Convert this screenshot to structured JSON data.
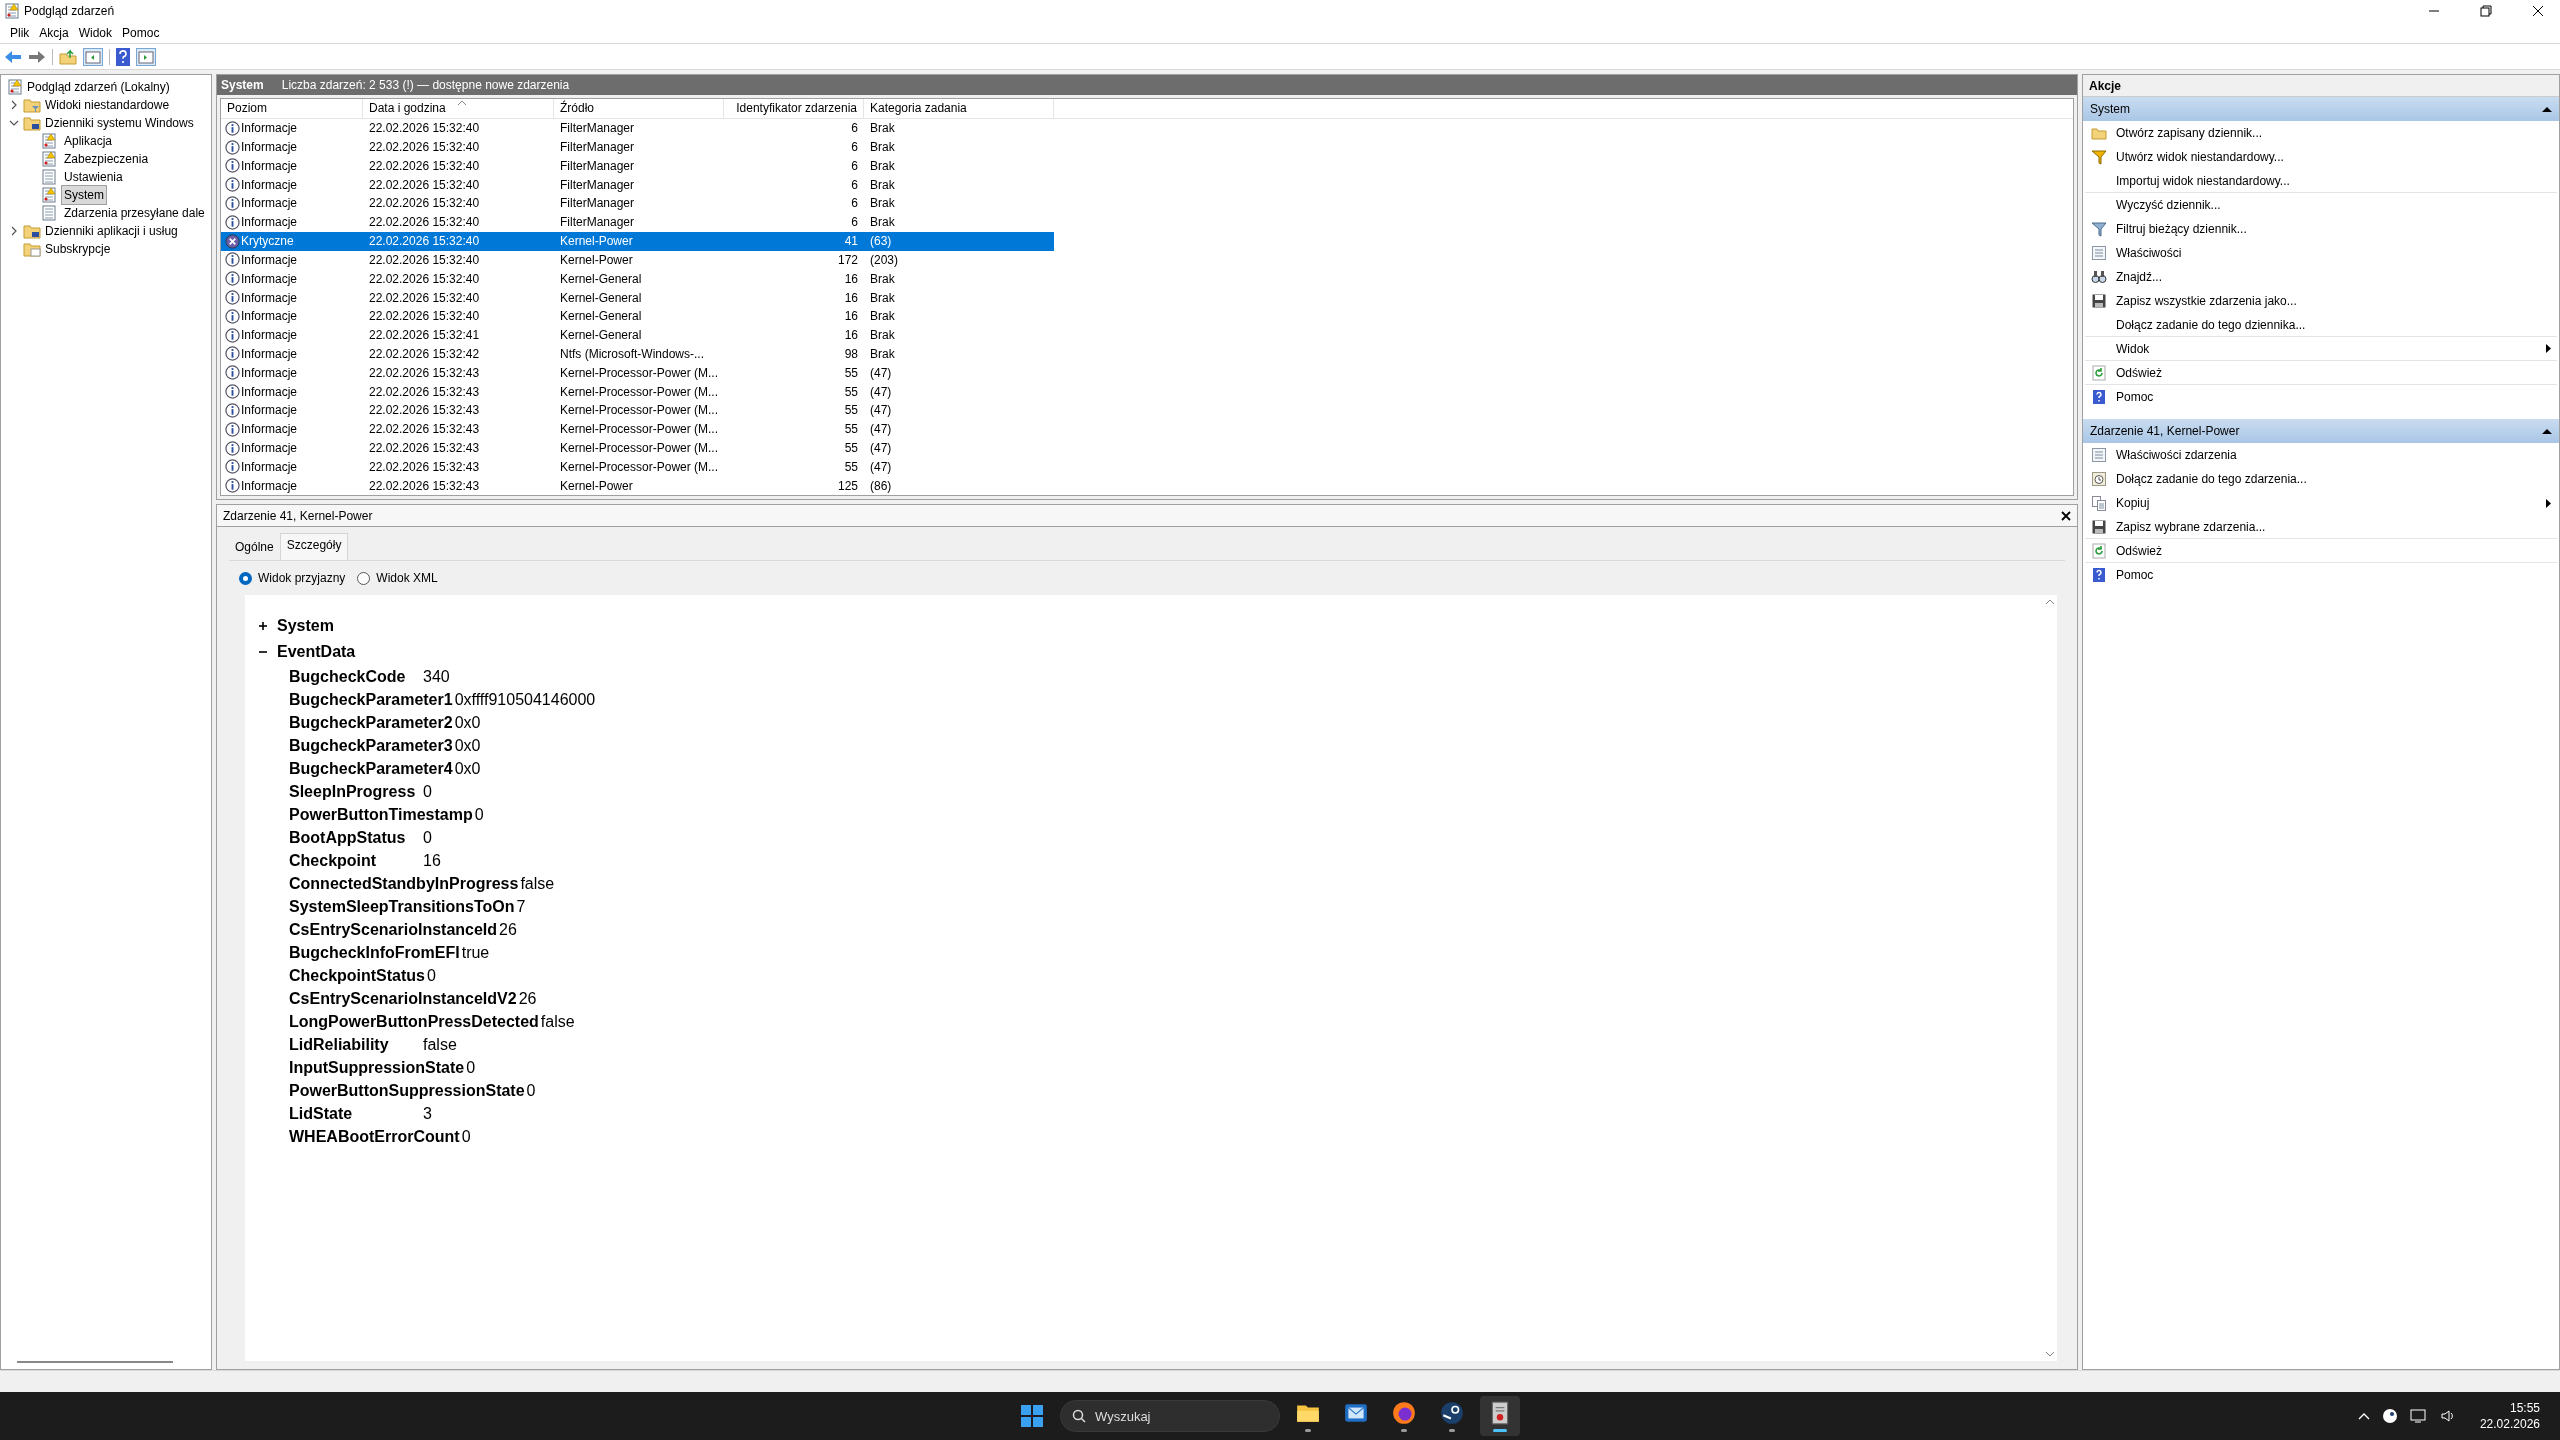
{
  "window": {
    "title": "Podgląd zdarzeń"
  },
  "menu": [
    "Plik",
    "Akcja",
    "Widok",
    "Pomoc"
  ],
  "tree": {
    "label": "Podgląd zdarzeń (Lokalny)",
    "children": [
      {
        "label": "Widoki niestandardowe",
        "kind": "filter-folder",
        "expander": true,
        "expanded": false
      },
      {
        "label": "Dzienniki systemu Windows",
        "kind": "folder",
        "expander": true,
        "expanded": true,
        "children": [
          {
            "label": "Aplikacja",
            "kind": "log-alert",
            "selected": false
          },
          {
            "label": "Zabezpieczenia",
            "kind": "log-alert",
            "selected": false
          },
          {
            "label": "Ustawienia",
            "kind": "log",
            "selected": false
          },
          {
            "label": "System",
            "kind": "log-alert",
            "selected": true
          },
          {
            "label": "Zdarzenia przesyłane dale",
            "kind": "log",
            "selected": false
          }
        ]
      },
      {
        "label": "Dzienniki aplikacji i usług",
        "kind": "folder",
        "expander": true,
        "expanded": false
      },
      {
        "label": "Subskrypcje",
        "kind": "subscription",
        "expander": false
      }
    ]
  },
  "log_header": {
    "title": "System",
    "summary": "Liczba zdarzeń: 2 533 (!) — dostępne nowe zdarzenia"
  },
  "table": {
    "columns": [
      {
        "label": "Poziom",
        "sorted": false
      },
      {
        "label": "Data i godzina",
        "sorted": true
      },
      {
        "label": "Źródło",
        "sorted": false
      },
      {
        "label": "Identyfikator zdarzenia",
        "sorted": false
      },
      {
        "label": "Kategoria zadania",
        "sorted": false
      }
    ],
    "rows": [
      {
        "kind": "info",
        "severity": "Informacje",
        "date": "22.02.2026 15:32:40",
        "source": "FilterManager",
        "id": "6",
        "category": "Brak",
        "selected": false
      },
      {
        "kind": "info",
        "severity": "Informacje",
        "date": "22.02.2026 15:32:40",
        "source": "FilterManager",
        "id": "6",
        "category": "Brak",
        "selected": false
      },
      {
        "kind": "info",
        "severity": "Informacje",
        "date": "22.02.2026 15:32:40",
        "source": "FilterManager",
        "id": "6",
        "category": "Brak",
        "selected": false
      },
      {
        "kind": "info",
        "severity": "Informacje",
        "date": "22.02.2026 15:32:40",
        "source": "FilterManager",
        "id": "6",
        "category": "Brak",
        "selected": false
      },
      {
        "kind": "info",
        "severity": "Informacje",
        "date": "22.02.2026 15:32:40",
        "source": "FilterManager",
        "id": "6",
        "category": "Brak",
        "selected": false
      },
      {
        "kind": "info",
        "severity": "Informacje",
        "date": "22.02.2026 15:32:40",
        "source": "FilterManager",
        "id": "6",
        "category": "Brak",
        "selected": false
      },
      {
        "kind": "critical",
        "severity": "Krytyczne",
        "date": "22.02.2026 15:32:40",
        "source": "Kernel-Power",
        "id": "41",
        "category": "(63)",
        "selected": true
      },
      {
        "kind": "info",
        "severity": "Informacje",
        "date": "22.02.2026 15:32:40",
        "source": "Kernel-Power",
        "id": "172",
        "category": "(203)",
        "selected": false
      },
      {
        "kind": "info",
        "severity": "Informacje",
        "date": "22.02.2026 15:32:40",
        "source": "Kernel-General",
        "id": "16",
        "category": "Brak",
        "selected": false
      },
      {
        "kind": "info",
        "severity": "Informacje",
        "date": "22.02.2026 15:32:40",
        "source": "Kernel-General",
        "id": "16",
        "category": "Brak",
        "selected": false
      },
      {
        "kind": "info",
        "severity": "Informacje",
        "date": "22.02.2026 15:32:40",
        "source": "Kernel-General",
        "id": "16",
        "category": "Brak",
        "selected": false
      },
      {
        "kind": "info",
        "severity": "Informacje",
        "date": "22.02.2026 15:32:41",
        "source": "Kernel-General",
        "id": "16",
        "category": "Brak",
        "selected": false
      },
      {
        "kind": "info",
        "severity": "Informacje",
        "date": "22.02.2026 15:32:42",
        "source": "Ntfs (Microsoft-Windows-...",
        "id": "98",
        "category": "Brak",
        "selected": false
      },
      {
        "kind": "info",
        "severity": "Informacje",
        "date": "22.02.2026 15:32:43",
        "source": "Kernel-Processor-Power (M...",
        "id": "55",
        "category": "(47)",
        "selected": false
      },
      {
        "kind": "info",
        "severity": "Informacje",
        "date": "22.02.2026 15:32:43",
        "source": "Kernel-Processor-Power (M...",
        "id": "55",
        "category": "(47)",
        "selected": false
      },
      {
        "kind": "info",
        "severity": "Informacje",
        "date": "22.02.2026 15:32:43",
        "source": "Kernel-Processor-Power (M...",
        "id": "55",
        "category": "(47)",
        "selected": false
      },
      {
        "kind": "info",
        "severity": "Informacje",
        "date": "22.02.2026 15:32:43",
        "source": "Kernel-Processor-Power (M...",
        "id": "55",
        "category": "(47)",
        "selected": false
      },
      {
        "kind": "info",
        "severity": "Informacje",
        "date": "22.02.2026 15:32:43",
        "source": "Kernel-Processor-Power (M...",
        "id": "55",
        "category": "(47)",
        "selected": false
      },
      {
        "kind": "info",
        "severity": "Informacje",
        "date": "22.02.2026 15:32:43",
        "source": "Kernel-Processor-Power (M...",
        "id": "55",
        "category": "(47)",
        "selected": false
      },
      {
        "kind": "info",
        "severity": "Informacje",
        "date": "22.02.2026 15:32:43",
        "source": "Kernel-Power",
        "id": "125",
        "category": "(86)",
        "selected": false
      }
    ]
  },
  "details": {
    "title": "Zdarzenie 41, Kernel-Power",
    "tabs": [
      {
        "label": "Ogólne",
        "selected": false
      },
      {
        "label": "Szczegóły",
        "selected": true
      }
    ],
    "view_options": [
      {
        "label": "Widok przyjazny",
        "selected": true
      },
      {
        "label": "Widok XML",
        "selected": false
      }
    ],
    "sections": [
      {
        "label": "System",
        "expanded": false
      },
      {
        "label": "EventData",
        "expanded": true,
        "fields": [
          {
            "name": "BugcheckCode",
            "value": "340"
          },
          {
            "name": "BugcheckParameter1",
            "value": "0xffff910504146000"
          },
          {
            "name": "BugcheckParameter2",
            "value": "0x0"
          },
          {
            "name": "BugcheckParameter3",
            "value": "0x0"
          },
          {
            "name": "BugcheckParameter4",
            "value": "0x0"
          },
          {
            "name": "SleepInProgress",
            "value": "0"
          },
          {
            "name": "PowerButtonTimestamp",
            "value": "0"
          },
          {
            "name": "BootAppStatus",
            "value": "0"
          },
          {
            "name": "Checkpoint",
            "value": "16"
          },
          {
            "name": "ConnectedStandbyInProgress",
            "value": "false"
          },
          {
            "name": "SystemSleepTransitionsToOn",
            "value": "7"
          },
          {
            "name": "CsEntryScenarioInstanceId",
            "value": "26"
          },
          {
            "name": "BugcheckInfoFromEFI",
            "value": "true"
          },
          {
            "name": "CheckpointStatus",
            "value": "0"
          },
          {
            "name": "CsEntryScenarioInstanceIdV2",
            "value": "26"
          },
          {
            "name": "LongPowerButtonPressDetected",
            "value": "false"
          },
          {
            "name": "LidReliability",
            "value": "false"
          },
          {
            "name": "InputSuppressionState",
            "value": "0"
          },
          {
            "name": "PowerButtonSuppressionState",
            "value": "0"
          },
          {
            "name": "LidState",
            "value": "3"
          },
          {
            "name": "WHEABootErrorCount",
            "value": "0"
          }
        ]
      }
    ]
  },
  "actions": {
    "title": "Akcje",
    "groups": [
      {
        "title": "System",
        "expanded": true,
        "items": [
          {
            "label": "Otwórz zapisany dziennik...",
            "kind": "open",
            "submenu": false,
            "divider_after": false
          },
          {
            "label": "Utwórz widok niestandardowy...",
            "kind": "filter-new",
            "submenu": false,
            "divider_after": false
          },
          {
            "label": "Importuj widok niestandardowy...",
            "kind": "none",
            "submenu": false,
            "divider_after": true
          },
          {
            "label": "Wyczyść dziennik...",
            "kind": "none",
            "submenu": false,
            "divider_after": false
          },
          {
            "label": "Filtruj bieżący dziennik...",
            "kind": "filter",
            "submenu": false,
            "divider_after": false
          },
          {
            "label": "Właściwości",
            "kind": "properties",
            "submenu": false,
            "divider_after": false
          },
          {
            "label": "Znajdź...",
            "kind": "find",
            "submenu": false,
            "divider_after": false
          },
          {
            "label": "Zapisz wszystkie zdarzenia jako...",
            "kind": "save",
            "submenu": false,
            "divider_after": false
          },
          {
            "label": "Dołącz zadanie do tego dziennika...",
            "kind": "none",
            "submenu": false,
            "divider_after": true
          },
          {
            "label": "Widok",
            "kind": "none",
            "submenu": true,
            "divider_after": true
          },
          {
            "label": "Odśwież",
            "kind": "refresh",
            "submenu": false,
            "divider_after": true
          },
          {
            "label": "Pomoc",
            "kind": "help",
            "submenu": false,
            "divider_after": false
          }
        ]
      },
      {
        "title": "Zdarzenie 41, Kernel-Power",
        "expanded": true,
        "items": [
          {
            "label": "Właściwości zdarzenia",
            "kind": "properties",
            "submenu": false,
            "divider_after": false
          },
          {
            "label": "Dołącz zadanie do tego zdarzenia...",
            "kind": "task",
            "submenu": false,
            "divider_after": false
          },
          {
            "label": "Kopiuj",
            "kind": "copy",
            "submenu": true,
            "divider_after": false
          },
          {
            "label": "Zapisz wybrane zdarzenia...",
            "kind": "save",
            "submenu": false,
            "divider_after": true
          },
          {
            "label": "Odśwież",
            "kind": "refresh",
            "submenu": false,
            "divider_after": true
          },
          {
            "label": "Pomoc",
            "kind": "help",
            "submenu": false,
            "divider_after": false
          }
        ]
      }
    ]
  },
  "taskbar": {
    "search": {
      "placeholder": "Wyszukaj"
    },
    "apps": [
      {
        "kind": "explorer",
        "running": true,
        "selected": false
      },
      {
        "kind": "mail",
        "running": false,
        "selected": false
      },
      {
        "kind": "firefox",
        "running": true,
        "selected": false
      },
      {
        "kind": "steam",
        "running": true,
        "selected": false
      },
      {
        "kind": "eventviewer",
        "running": true,
        "selected": true
      }
    ],
    "clock": {
      "time": "15:55",
      "date": "22.02.2026"
    }
  }
}
